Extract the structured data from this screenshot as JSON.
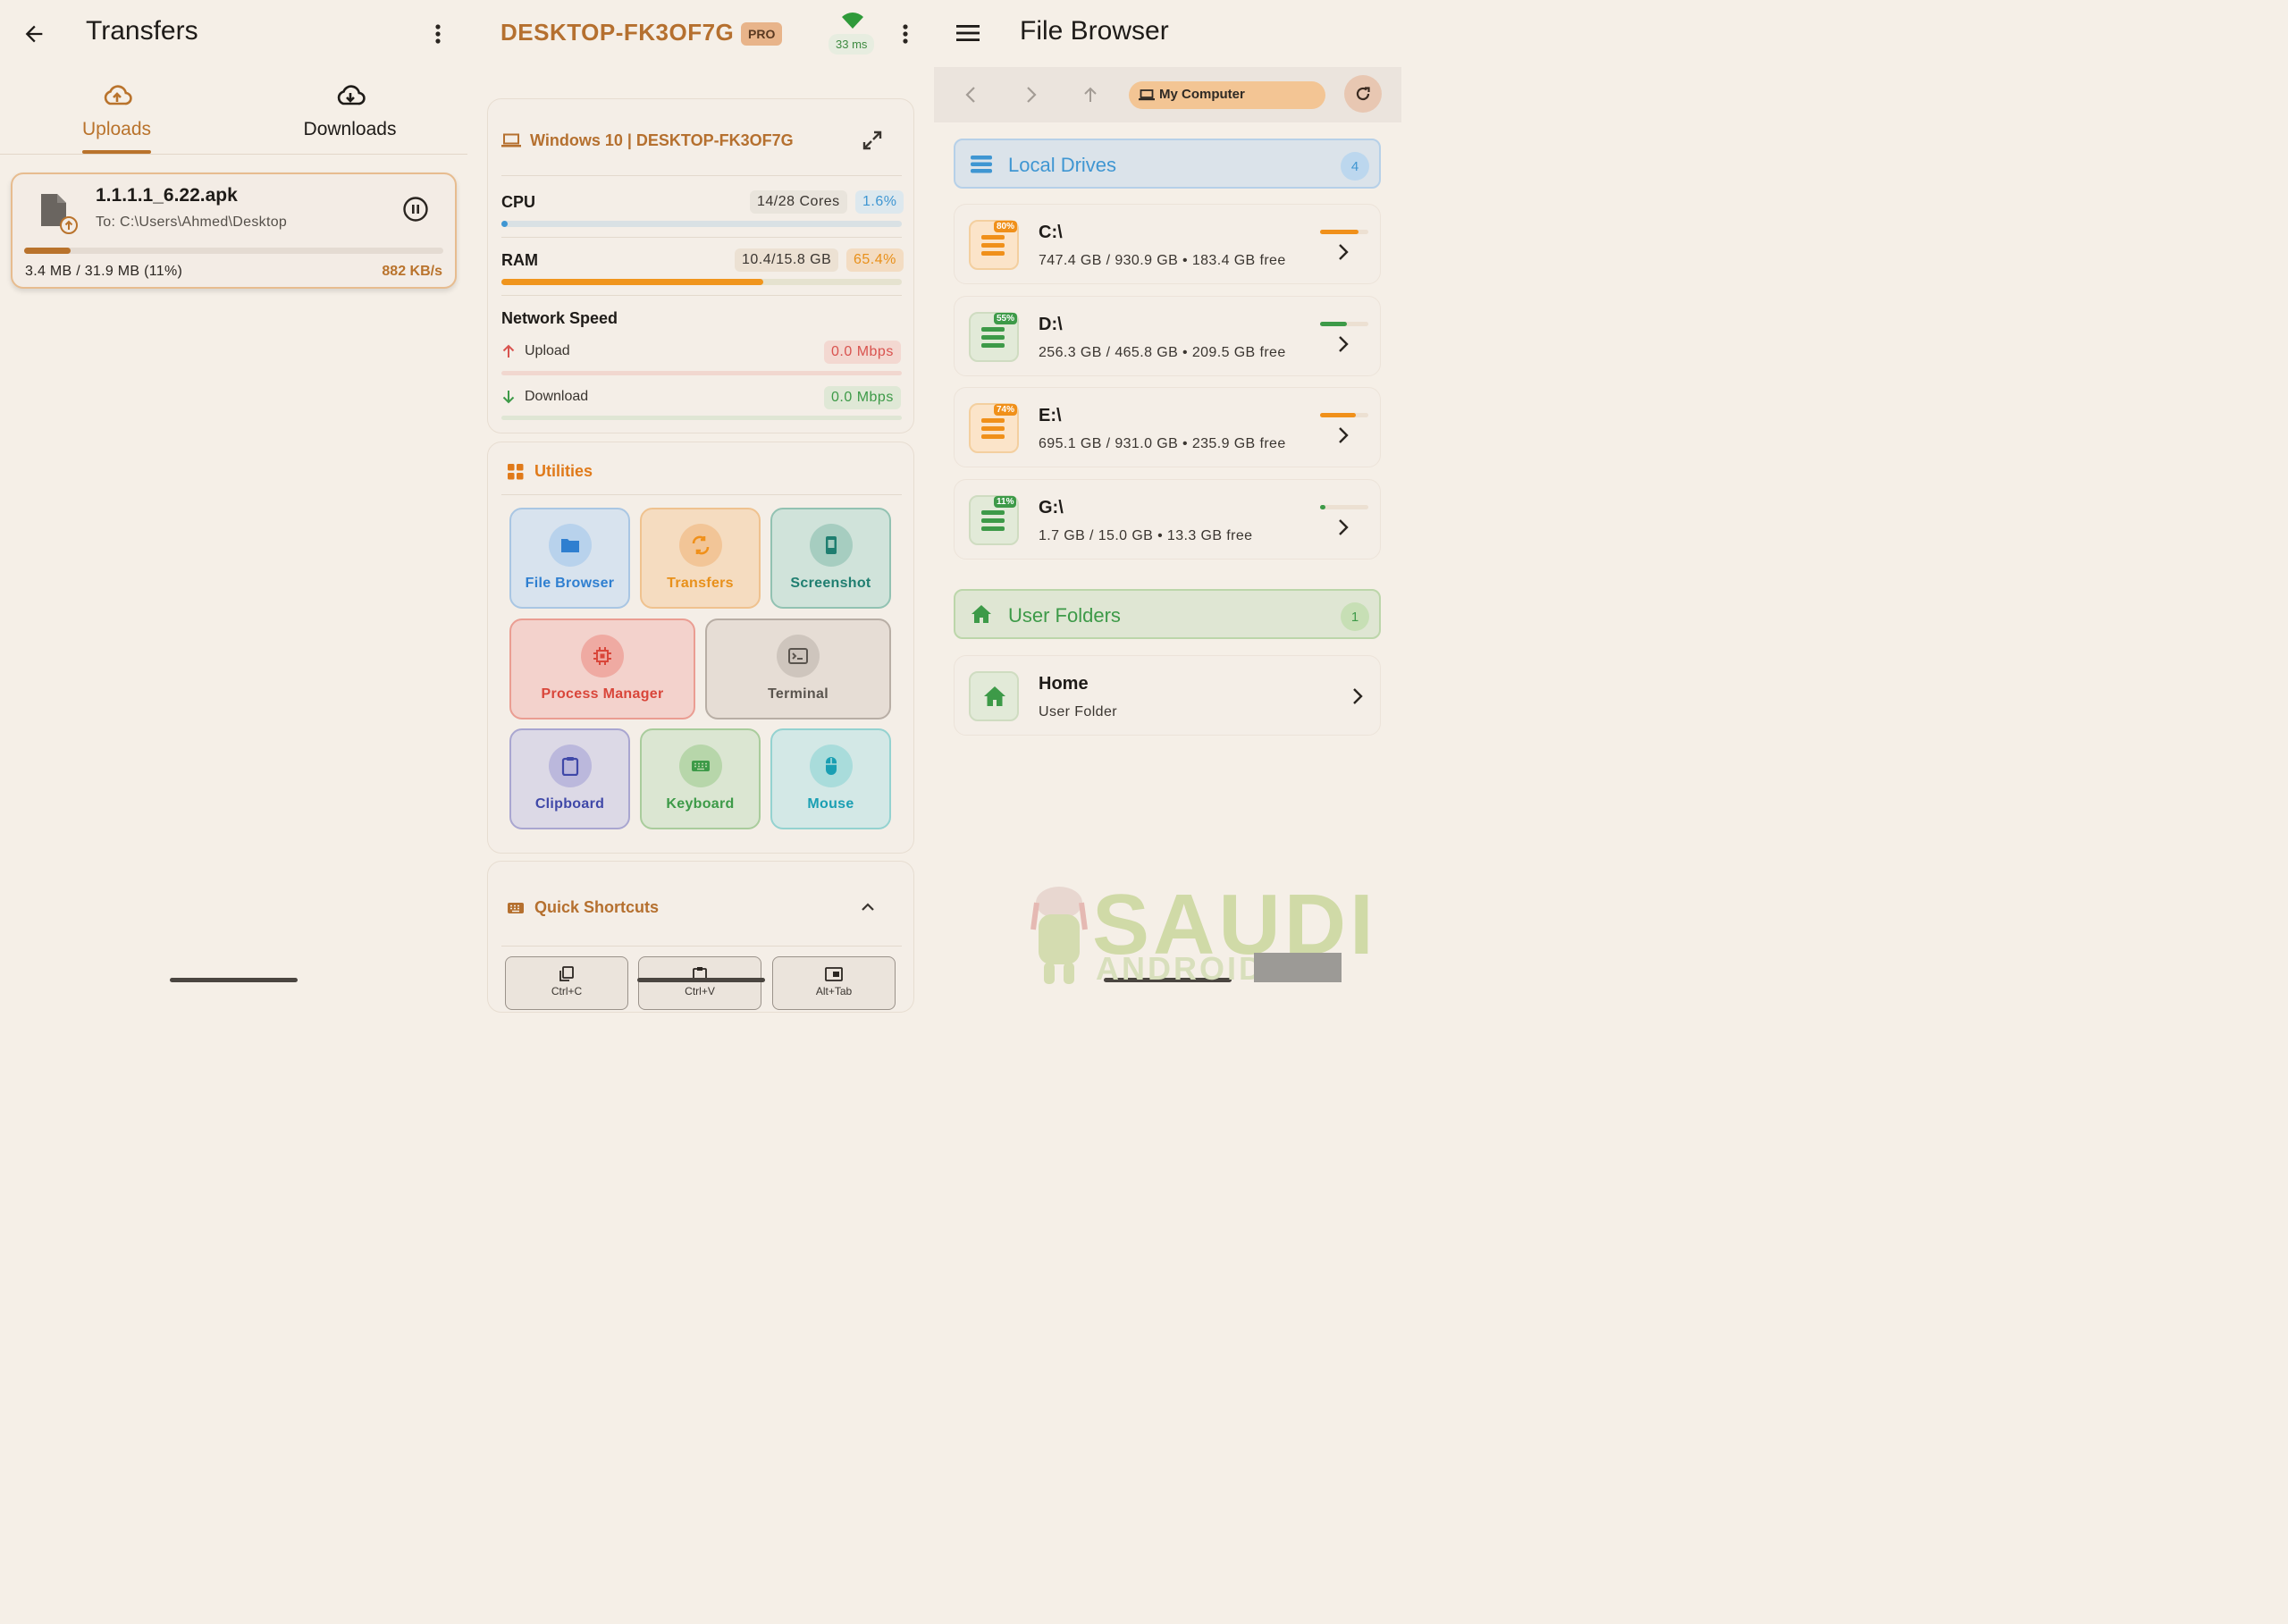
{
  "transfers": {
    "title": "Transfers",
    "tabs": [
      {
        "label": "Uploads",
        "active": true
      },
      {
        "label": "Downloads",
        "active": false
      }
    ],
    "item": {
      "filename": "1.1.1.1_6.22.apk",
      "destination": "To: C:\\Users\\Ahmed\\Desktop",
      "progress_text": "3.4 MB / 31.9 MB (11%)",
      "progress_fraction": 0.11,
      "speed": "882 KB/s"
    }
  },
  "device": {
    "name": "DESKTOP-FK3OF7G",
    "badge": "PRO",
    "ping": "33 ms",
    "system_title": "Windows 10 | DESKTOP-FK3OF7G",
    "cpu": {
      "label": "CPU",
      "cores": "14/28 Cores",
      "percent": "1.6%",
      "fraction": 0.016
    },
    "ram": {
      "label": "RAM",
      "usage": "10.4/15.8 GB",
      "percent": "65.4%",
      "fraction": 0.654
    },
    "network": {
      "title": "Network Speed",
      "upload_label": "Upload",
      "upload_value": "0.0 Mbps",
      "download_label": "Download",
      "download_value": "0.0 Mbps"
    },
    "utilities": {
      "title": "Utilities",
      "items": [
        "File Browser",
        "Transfers",
        "Screenshot",
        "Process Manager",
        "Terminal",
        "Clipboard",
        "Keyboard",
        "Mouse"
      ]
    },
    "shortcuts": {
      "title": "Quick Shortcuts",
      "items": [
        "Ctrl+C",
        "Ctrl+V",
        "Alt+Tab"
      ]
    }
  },
  "file_browser": {
    "title": "File Browser",
    "location": "My Computer",
    "local_drives": {
      "title": "Local Drives",
      "count": "4"
    },
    "drives": [
      {
        "name": "C:\\",
        "info": "747.4 GB / 930.9 GB • 183.4 GB free",
        "badge": "80%",
        "fraction": 0.8,
        "color": "#f0901a"
      },
      {
        "name": "D:\\",
        "info": "256.3 GB / 465.8 GB • 209.5 GB free",
        "badge": "55%",
        "fraction": 0.55,
        "color": "#3d9a48"
      },
      {
        "name": "E:\\",
        "info": "695.1 GB / 931.0 GB • 235.9 GB free",
        "badge": "74%",
        "fraction": 0.74,
        "color": "#f0901a"
      },
      {
        "name": "G:\\",
        "info": "1.7 GB / 15.0 GB • 13.3 GB free",
        "badge": "11%",
        "fraction": 0.11,
        "color": "#3d9a48"
      }
    ],
    "user_folders": {
      "title": "User Folders",
      "count": "1"
    },
    "folders": [
      {
        "name": "Home",
        "subtitle": "User Folder"
      }
    ]
  },
  "watermark": {
    "line1": "SAUDI",
    "line2": "ANDROID"
  }
}
